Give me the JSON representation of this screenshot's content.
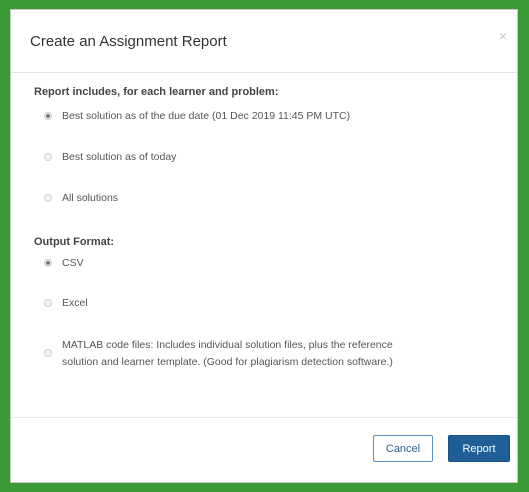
{
  "dialog": {
    "title": "Create an Assignment Report",
    "close_glyph": "×"
  },
  "includes": {
    "label": "Report includes, for each learner and problem:",
    "options": [
      {
        "label": "Best solution as of the due date (01 Dec 2019 11:45 PM UTC)",
        "checked": true
      },
      {
        "label": "Best solution as of today",
        "checked": false
      },
      {
        "label": "All solutions",
        "checked": false
      }
    ]
  },
  "format": {
    "label": "Output Format:",
    "options": [
      {
        "label": "CSV",
        "checked": true
      },
      {
        "label": "Excel",
        "checked": false
      },
      {
        "label_line1": "MATLAB code files: Includes individual solution files, plus the reference",
        "label_line2": "solution and learner template. (Good for plagiarism detection software.)",
        "checked": false
      }
    ]
  },
  "buttons": {
    "cancel": "Cancel",
    "report": "Report"
  },
  "colors": {
    "frame": "#3a9a35",
    "primary": "#1f5f96"
  }
}
